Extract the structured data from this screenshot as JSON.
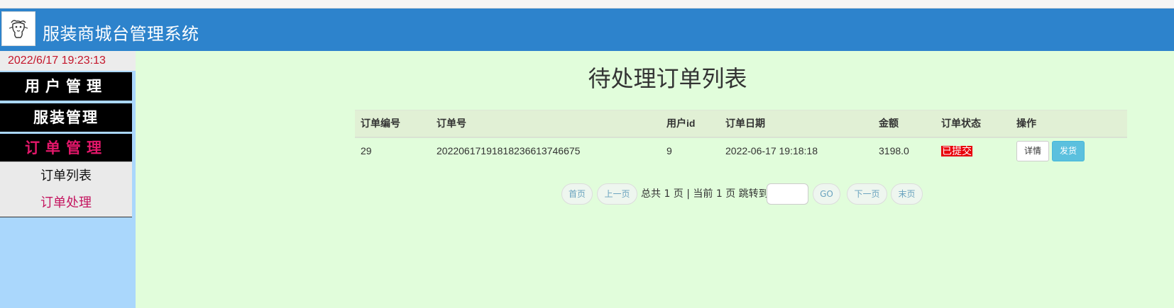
{
  "app": {
    "title": "服装商城台管理系统",
    "logo_icon": "goat-mascot-icon"
  },
  "sidebar": {
    "datetime": "2022/6/17 19:23:13",
    "sections": [
      {
        "label": "用户管理"
      },
      {
        "label": "服装管理"
      },
      {
        "label": "订单管理",
        "active": true
      }
    ],
    "sub_items": [
      {
        "label": "订单列表"
      },
      {
        "label": "订单处理",
        "active": true
      }
    ]
  },
  "main": {
    "title": "待处理订单列表",
    "table": {
      "columns": [
        "订单编号",
        "订单号",
        "用户id",
        "订单日期",
        "金额",
        "订单状态",
        "操作"
      ],
      "rows": [
        {
          "id": "29",
          "order_no": "20220617191818236613746675",
          "user_id": "9",
          "date": "2022-06-17 19:18:18",
          "amount": "3198.0",
          "status": "已提交",
          "actions": {
            "detail": "详情",
            "ship": "发货"
          }
        }
      ]
    },
    "pagination": {
      "first": "首页",
      "prev": "上一页",
      "summary": "总共 1 页 | 当前 1 页 跳转到",
      "jump_value": "",
      "go": "GO",
      "next": "下一页",
      "last": "末页"
    }
  },
  "colors": {
    "header_bg": "#2d83cc",
    "sidebar_bg": "#aad7fc",
    "main_bg": "#e1fddb",
    "status_badge": "#e8000b",
    "active_nav": "#e3176a",
    "clock_text": "#c4152a",
    "ship_button": "#5bc0de"
  }
}
